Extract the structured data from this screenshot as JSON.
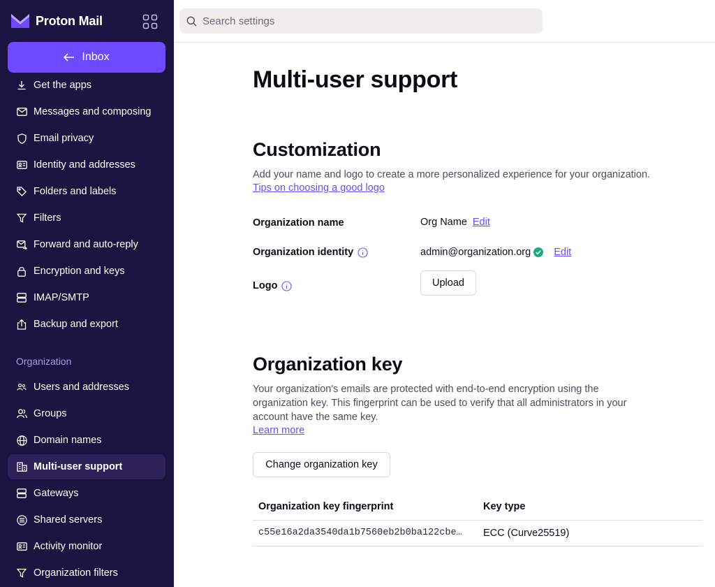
{
  "brand": {
    "name": "Proton Mail",
    "logo_color": "#6d4aff"
  },
  "sidebar": {
    "inbox_label": "Inbox",
    "items": [
      {
        "label": "Get the apps",
        "icon": "download-icon"
      },
      {
        "label": "Messages and composing",
        "icon": "envelope-icon"
      },
      {
        "label": "Email privacy",
        "icon": "shield-icon"
      },
      {
        "label": "Identity and addresses",
        "icon": "id-card-icon"
      },
      {
        "label": "Folders and labels",
        "icon": "tag-icon"
      },
      {
        "label": "Filters",
        "icon": "filter-icon"
      },
      {
        "label": "Forward and auto-reply",
        "icon": "forward-icon"
      },
      {
        "label": "Encryption and keys",
        "icon": "lock-icon"
      },
      {
        "label": "IMAP/SMTP",
        "icon": "servers-icon"
      },
      {
        "label": "Backup and export",
        "icon": "export-icon"
      }
    ],
    "section_label": "Organization",
    "org_items": [
      {
        "label": "Users and addresses",
        "icon": "users-icon"
      },
      {
        "label": "Groups",
        "icon": "group-icon"
      },
      {
        "label": "Domain names",
        "icon": "globe-icon"
      },
      {
        "label": "Multi-user support",
        "icon": "building-icon",
        "active": true
      },
      {
        "label": "Gateways",
        "icon": "servers-icon"
      },
      {
        "label": "Shared servers",
        "icon": "shared-servers-icon"
      },
      {
        "label": "Activity monitor",
        "icon": "id-card-icon"
      },
      {
        "label": "Organization filters",
        "icon": "filter-icon"
      }
    ]
  },
  "search": {
    "placeholder": "Search settings"
  },
  "page": {
    "title": "Multi-user support"
  },
  "customization": {
    "title": "Customization",
    "description": "Add your name and logo to create a more personalized experience for your organization.",
    "tips_link": "Tips on choosing a good logo",
    "org_name_label": "Organization name",
    "org_name_value": "Org Name",
    "org_name_edit": "Edit",
    "org_identity_label": "Organization identity",
    "org_identity_value": "admin@organization.org",
    "org_identity_edit": "Edit",
    "logo_label": "Logo",
    "upload_label": "Upload"
  },
  "org_key": {
    "title": "Organization key",
    "description": "Your organization's emails are protected with end-to-end encryption using the organization key. This fingerprint can be used to verify that all administrators in your account have the same key.",
    "learn_more": "Learn more",
    "change_button": "Change organization key",
    "columns": [
      "Organization key fingerprint",
      "Key type"
    ],
    "rows": [
      {
        "fingerprint": "c55e16a2da3540da1b7560eb2b0ba122cbe…",
        "key_type": "ECC (Curve25519)"
      }
    ]
  },
  "colors": {
    "sidebar_bg": "#1b1340",
    "accent": "#6d4aff",
    "verified": "#1ea885"
  }
}
